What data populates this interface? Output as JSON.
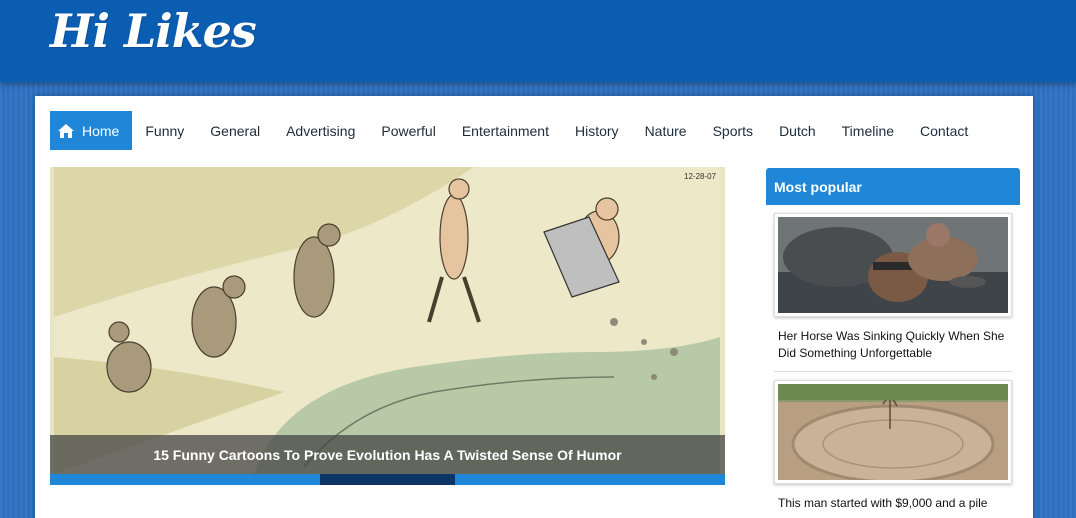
{
  "site": {
    "logo_text": "Hi Likes"
  },
  "nav": {
    "items": [
      {
        "label": "Home",
        "active": true,
        "icon": "home-icon"
      },
      {
        "label": "Funny"
      },
      {
        "label": "General"
      },
      {
        "label": "Advertising"
      },
      {
        "label": "Powerful"
      },
      {
        "label": "Entertainment"
      },
      {
        "label": "History"
      },
      {
        "label": "Nature"
      },
      {
        "label": "Sports"
      },
      {
        "label": "Dutch"
      },
      {
        "label": "Timeline"
      },
      {
        "label": "Contact"
      }
    ]
  },
  "slider": {
    "caption": "15 Funny Cartoons To Prove Evolution Has A Twisted Sense Of Humor",
    "image_date": "12-28-07",
    "slide_count": 5,
    "active_slide": 3
  },
  "sidebar": {
    "heading": "Most popular",
    "items": [
      {
        "title": "Her Horse Was Sinking Quickly When She Did Something Unforgettable"
      },
      {
        "title": "This man started with $9,000 and a pile"
      }
    ]
  },
  "colors": {
    "header_blue": "#0b5db2",
    "accent_blue": "#1f86d8",
    "active_slide_segment": "#0c3464"
  }
}
